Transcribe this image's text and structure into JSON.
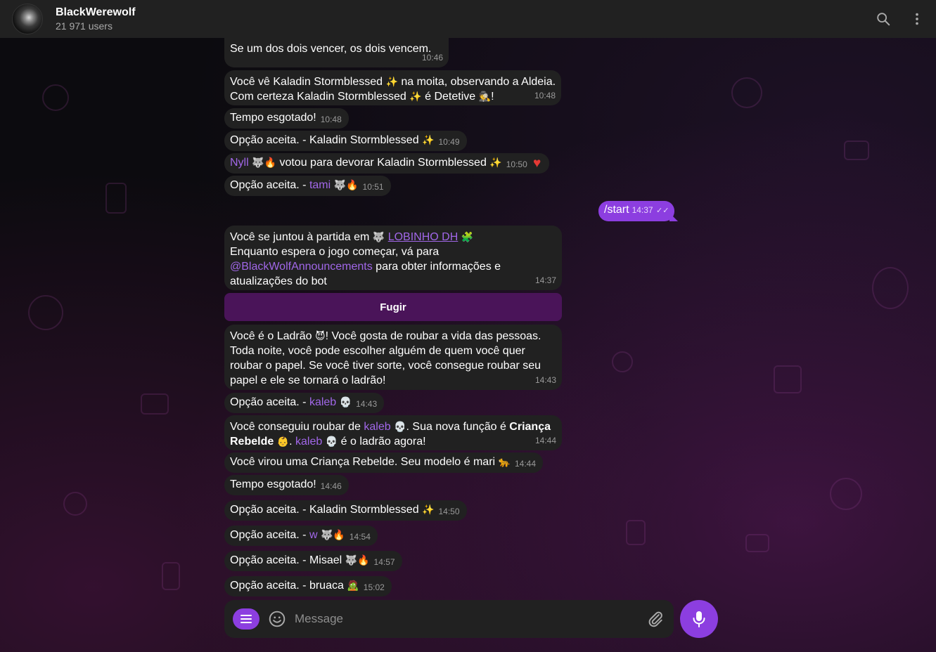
{
  "header": {
    "title": "BlackWerewolf",
    "subtitle": "21 971 users"
  },
  "messages": [
    {
      "id": "m1",
      "text": "Se um dos dois vencer, os dois vencem.",
      "time": "10:46"
    },
    {
      "id": "m2",
      "line1a": "Você vê Kaladin Stormblessed",
      "line1b": "na moita, observando a Aldeia.",
      "line2a": "Com certeza Kaladin Stormblessed",
      "line2b": "é Detetive",
      "line2c": "!",
      "time": "10:48"
    },
    {
      "id": "m3",
      "text": "Tempo esgotado!",
      "time": "10:48"
    },
    {
      "id": "m4",
      "text": "Opção aceita. - Kaladin Stormblessed",
      "time": "10:49"
    },
    {
      "id": "m5",
      "user": "Nyll",
      "text": "votou para devorar Kaladin Stormblessed",
      "time": "10:50"
    },
    {
      "id": "m6",
      "text": "Opção aceita. -",
      "user": "tami",
      "time": "10:51"
    },
    {
      "id": "m8",
      "line1a": "Você se juntou à partida em",
      "link": "LOBINHO DH",
      "line2": "Enquanto espera o jogo começar, vá para",
      "mention": "@BlackWolfAnnouncements",
      "line3b": "para obter informações e",
      "line4": "atualizações do bot",
      "time": "14:37"
    },
    {
      "id": "m9",
      "line1a": "Você é o Ladrão",
      "line1b": "! Você gosta de roubar a vida das pessoas.",
      "line2": "Toda noite, você pode escolher alguém de quem você quer",
      "line3": "roubar o papel. Se você tiver sorte, você consegue roubar seu",
      "line4": "papel e ele se tornará o ladrão!",
      "time": "14:43"
    },
    {
      "id": "m10",
      "text": "Opção aceita. -",
      "user": "kaleb",
      "time": "14:43"
    },
    {
      "id": "m11",
      "line1a": "Você conseguiu roubar de",
      "user": "kaleb",
      "line1b": ". Sua nova função é",
      "role1": "Criança",
      "role2": "Rebelde",
      "line2b": "é o ladrão agora!",
      "time": "14:44"
    },
    {
      "id": "m12",
      "text": "Você virou uma Criança Rebelde. Seu modelo é mari",
      "time": "14:44"
    },
    {
      "id": "m13",
      "text": "Tempo esgotado!",
      "time": "14:46"
    },
    {
      "id": "m14",
      "text": "Opção aceita. - Kaladin Stormblessed",
      "time": "14:50"
    },
    {
      "id": "m15",
      "text": "Opção aceita. -",
      "user": "w",
      "time": "14:54"
    },
    {
      "id": "m16",
      "text": "Opção aceita. - Misael",
      "time": "14:57"
    },
    {
      "id": "m17",
      "text": "Opção aceita. - bruaca",
      "time": "15:02"
    }
  ],
  "outgoing": {
    "text": "/start",
    "time": "14:37"
  },
  "inline_button": "Fugir",
  "composer": {
    "placeholder": "Message"
  },
  "icons": {
    "search": "search-icon",
    "menu": "more-vert-icon",
    "bot_menu": "bot-menu-icon",
    "emoji": "emoji-icon",
    "attach": "paperclip-icon",
    "mic": "microphone-icon"
  },
  "colors": {
    "accent": "#8c3ee0",
    "link": "#a167e8",
    "bubble": "#212121",
    "header": "#212121",
    "inline_button": "#4a1459"
  }
}
